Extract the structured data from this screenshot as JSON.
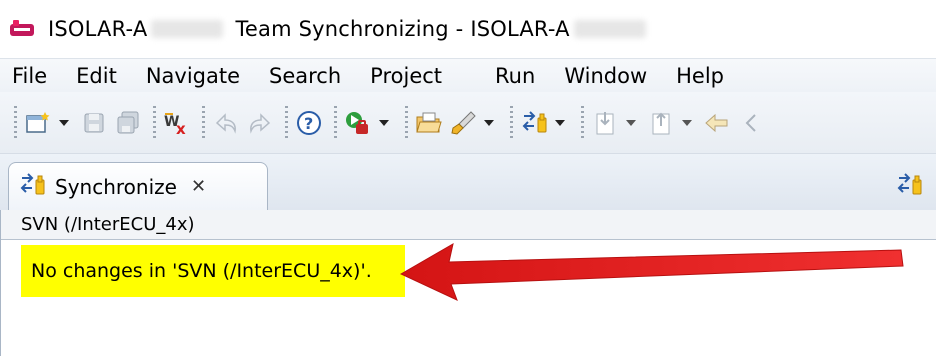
{
  "window": {
    "title_left": "ISOLAR-A",
    "title_middle": "Team Synchronizing - ISOLAR-A"
  },
  "menu": [
    "File",
    "Edit",
    "Navigate",
    "Search",
    "Project",
    "Run",
    "Window",
    "Help"
  ],
  "toolbar": {
    "icons": [
      "new-wizard-icon",
      "save-icon",
      "save-all-icon",
      "wx-icon",
      "undo-icon",
      "redo-icon",
      "help-icon",
      "run-icon",
      "open-folder-icon",
      "brush-icon",
      "synchronize-icon",
      "import-icon",
      "export-icon",
      "back-icon"
    ]
  },
  "view": {
    "tab_label": "Synchronize",
    "tab_close": "✕",
    "panel_header": "SVN (/InterECU_4x)",
    "message": "No changes in 'SVN (/InterECU_4x)'."
  },
  "colors": {
    "highlight": "#ffff00",
    "arrow": "#e31b1b"
  }
}
